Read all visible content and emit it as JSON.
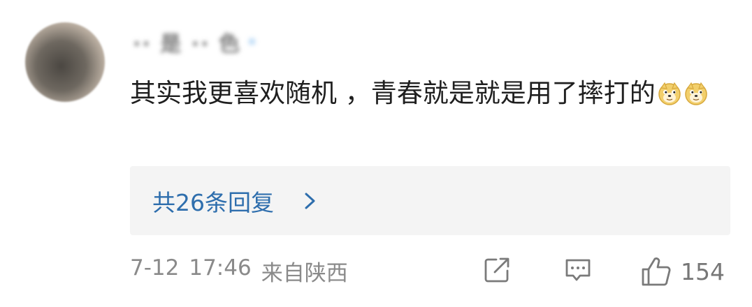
{
  "user": {
    "name_blurred": "·· 是 ·· 色",
    "name_blurred_tail": "·"
  },
  "comment": {
    "text": "其实我更喜欢随机 ，青春就是就是用了摔打的",
    "emojis": [
      "doge-emoji",
      "doge-emoji"
    ]
  },
  "replies": {
    "label": "共26条回复"
  },
  "footer": {
    "date": "7-12",
    "time": "17:46",
    "location": "来自陕西",
    "like_count": "154"
  },
  "colors": {
    "reply_link": "#2e6ead",
    "meta_gray": "#8a8a8a",
    "reply_bg": "#f4f4f4"
  }
}
